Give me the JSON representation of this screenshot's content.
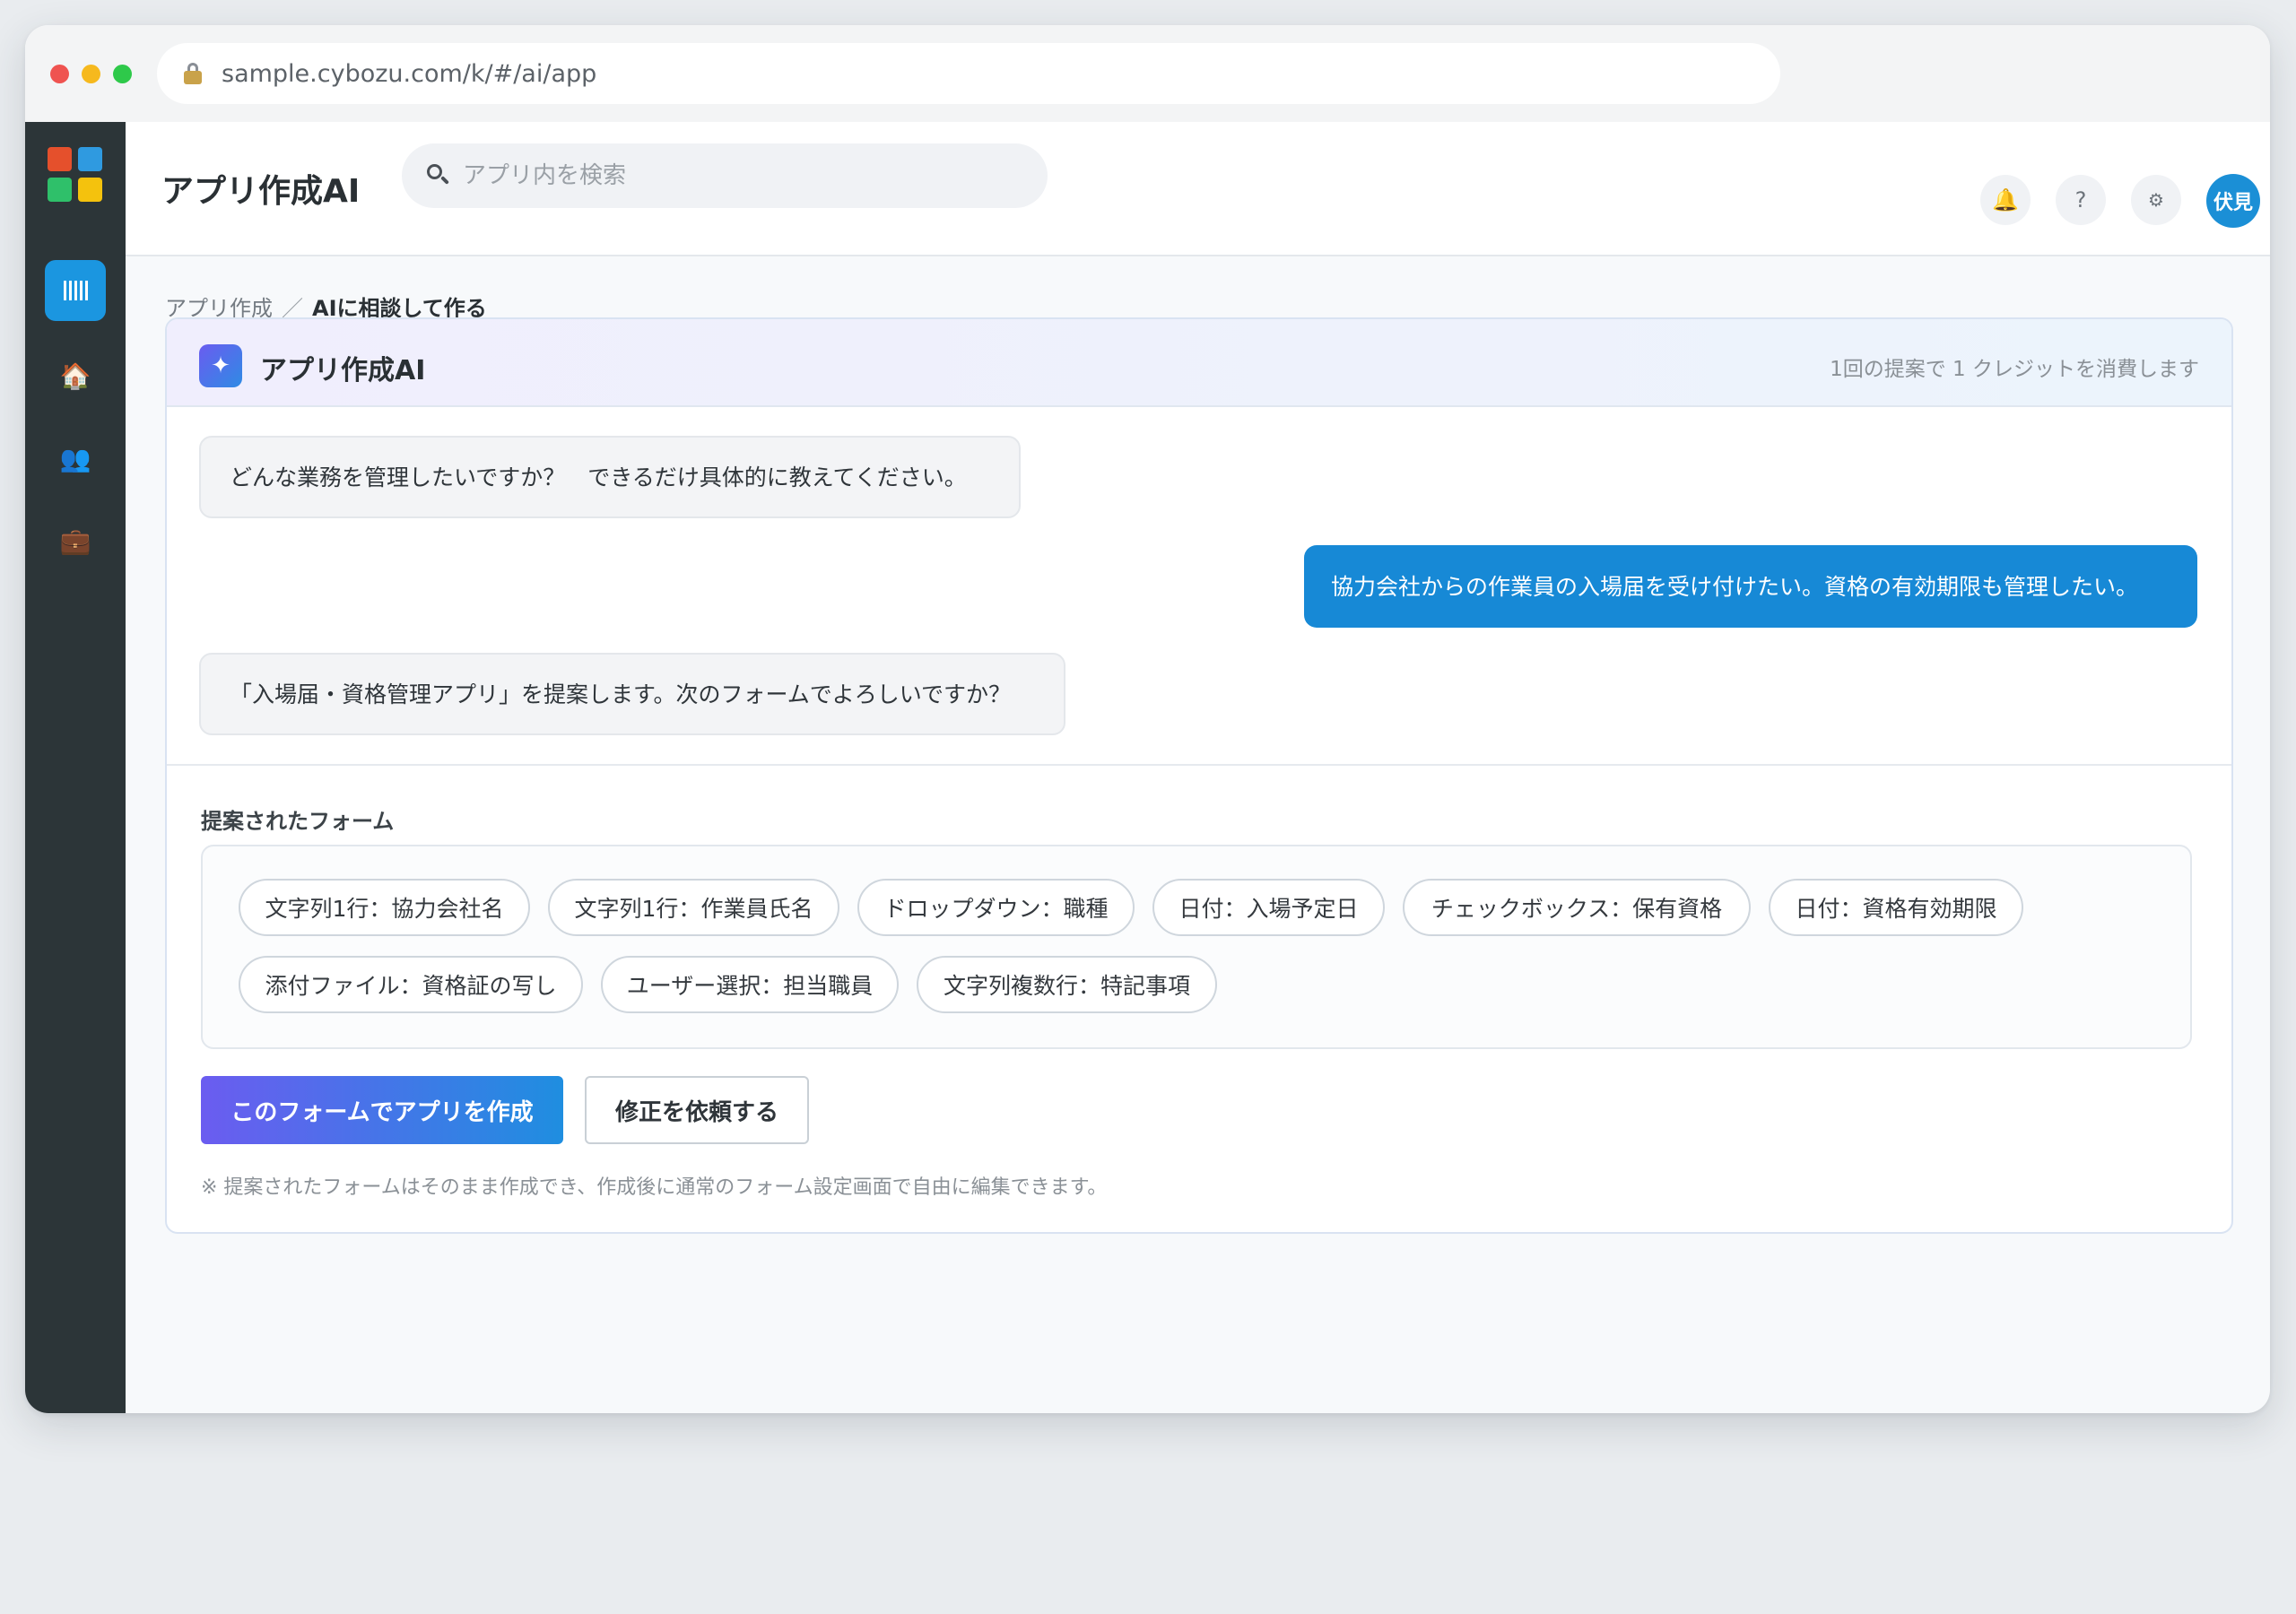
{
  "browser": {
    "url": "sample.cybozu.com/k/#/ai/app"
  },
  "sidebar": {
    "items": [
      {
        "icon": "apps-grid-icon",
        "active": true
      },
      {
        "icon": "house-icon",
        "glyph": "🏠"
      },
      {
        "icon": "people-icon",
        "glyph": "👥"
      },
      {
        "icon": "folder-icon",
        "glyph": "💼"
      }
    ]
  },
  "header": {
    "title": "アプリ作成AI",
    "search_placeholder": "アプリ内を検索",
    "bell_glyph": "🔔",
    "help_glyph": "?",
    "gear_glyph": "⚙",
    "avatar": "伏見"
  },
  "breadcrumb": {
    "parent": "アプリ作成",
    "separator": "／",
    "current": "AIに相談して作る"
  },
  "ai_panel": {
    "spark_glyph": "✦",
    "title": "アプリ作成AI",
    "credit_note": "1回の提案で 1 クレジットを消費します",
    "messages": [
      {
        "from": "ai",
        "text": "どんな業務を管理したいですか？　できるだけ具体的に教えてください。"
      },
      {
        "from": "user",
        "text": "協力会社からの作業員の入場届を受け付けたい。資格の有効期限も管理したい。"
      },
      {
        "from": "ai",
        "text": "「入場届・資格管理アプリ」を提案します。次のフォームでよろしいですか？"
      }
    ],
    "form_section_label": "提案されたフォーム",
    "fields": [
      "文字列1行：協力会社名",
      "文字列1行：作業員氏名",
      "ドロップダウン：職種",
      "日付：入場予定日",
      "チェックボックス：保有資格",
      "日付：資格有効期限",
      "添付ファイル：資格証の写し",
      "ユーザー選択：担当職員",
      "文字列複数行：特記事項"
    ],
    "create_button": "このフォームでアプリを作成",
    "revise_button": "修正を依頼する",
    "note": "※ 提案されたフォームはそのまま作成でき、作成後に通常のフォーム設定画面で自由に編集できます。"
  },
  "colors": {
    "accent": "#1789d6",
    "sidebar": "#2c3538",
    "gradient_start": "#6b5cf0"
  }
}
